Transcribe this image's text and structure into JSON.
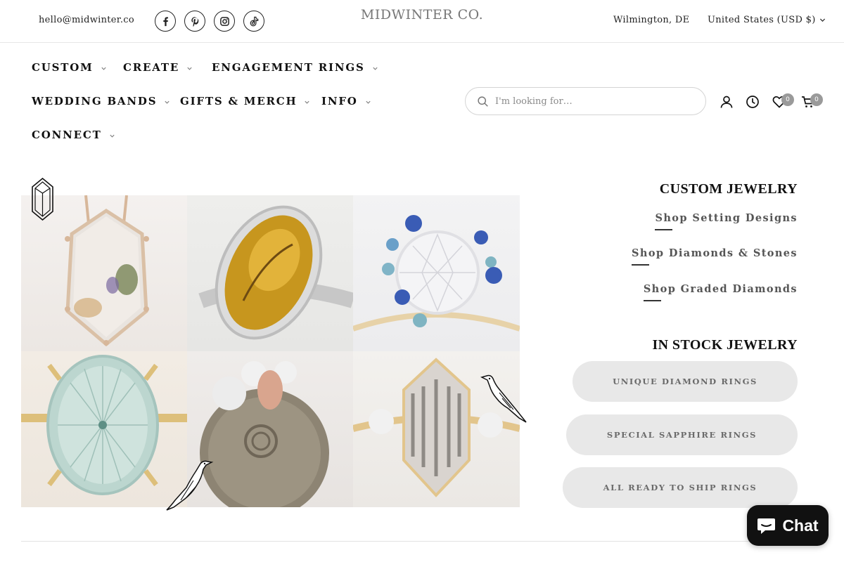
{
  "topbar": {
    "email": "hello@midwinter.co",
    "logo": "MIDWINTER CO.",
    "location": "Wilmington, DE",
    "currency": "United States (USD $)",
    "socials": [
      "facebook-icon",
      "pinterest-icon",
      "instagram-icon",
      "tiktok-icon"
    ]
  },
  "nav": {
    "items": [
      {
        "label": "CUSTOM"
      },
      {
        "label": "CREATE"
      },
      {
        "label": "ENGAGEMENT RINGS"
      },
      {
        "label": "WEDDING BANDS"
      },
      {
        "label": "GIFTS & MERCH"
      },
      {
        "label": "INFO"
      },
      {
        "label": "CONNECT"
      }
    ]
  },
  "search": {
    "placeholder": "I'm looking for…"
  },
  "header_icons": {
    "wishlist_count": "0",
    "cart_count": "0"
  },
  "custom_jewelry": {
    "title": "CUSTOM JEWELRY",
    "links": [
      "Shop Setting Designs",
      "Shop Diamonds & Stones",
      "Shop Graded Diamonds"
    ]
  },
  "in_stock": {
    "title": "IN STOCK JEWELRY",
    "buttons": [
      "UNIQUE DIAMOND RINGS",
      "SPECIAL SAPPHIRE RINGS",
      "ALL READY TO SHIP RINGS"
    ]
  },
  "chat": {
    "label": "Chat"
  },
  "colors": {
    "accent": "#111111",
    "pill": "#e8e8e8",
    "muted_text": "#6a6a6a"
  }
}
